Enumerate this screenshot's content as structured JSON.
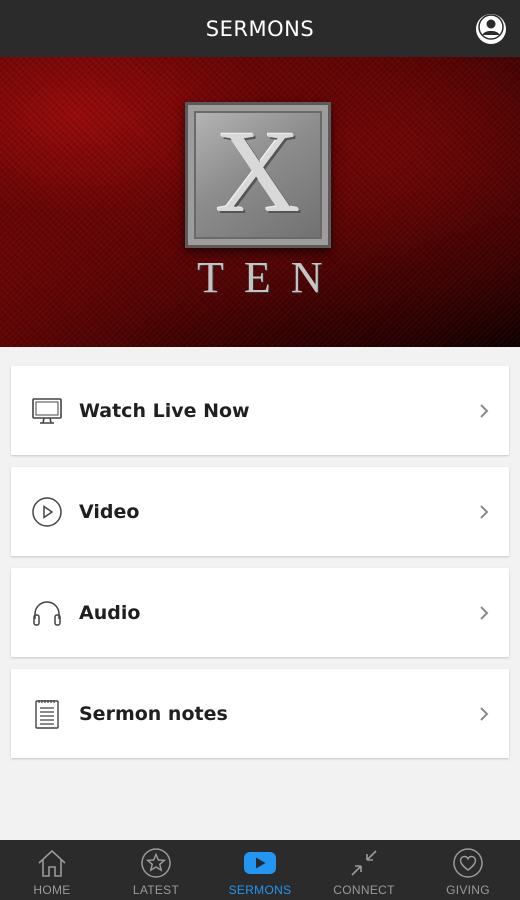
{
  "header": {
    "title": "SERMONS",
    "profile_icon": "user-profile-icon"
  },
  "hero": {
    "logo_letter": "X",
    "logo_word": "TEN",
    "background_color": "#7a0606"
  },
  "menu": {
    "items": [
      {
        "label": "Watch Live Now",
        "icon": "monitor-icon"
      },
      {
        "label": "Video",
        "icon": "play-circle-icon"
      },
      {
        "label": "Audio",
        "icon": "headphones-icon"
      },
      {
        "label": "Sermon notes",
        "icon": "notes-icon"
      }
    ]
  },
  "tabbar": {
    "active_color": "#2196f3",
    "inactive_color": "#9a9a9a",
    "tabs": [
      {
        "label": "HOME",
        "icon": "home-icon",
        "active": false
      },
      {
        "label": "LATEST",
        "icon": "star-circle-icon",
        "active": false
      },
      {
        "label": "SERMONS",
        "icon": "youtube-play-icon",
        "active": true
      },
      {
        "label": "CONNECT",
        "icon": "connect-arrows-icon",
        "active": false
      },
      {
        "label": "GIVING",
        "icon": "heart-circle-icon",
        "active": false
      }
    ]
  }
}
